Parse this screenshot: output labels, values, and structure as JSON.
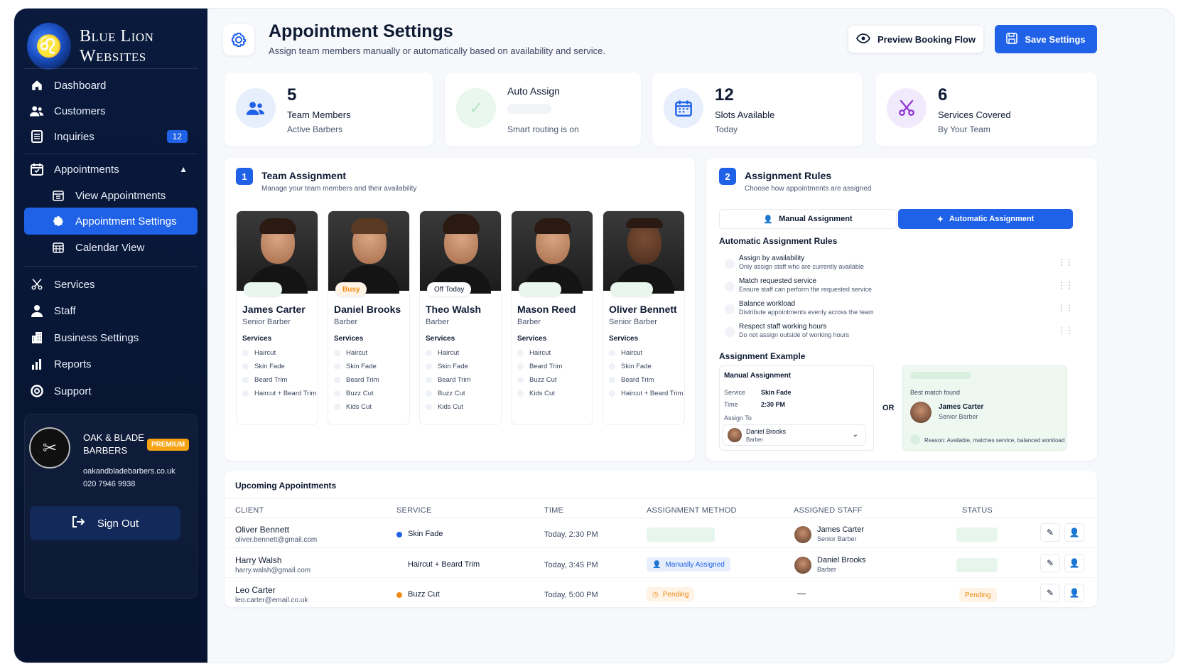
{
  "brand": {
    "name": "Blue Lion Websites",
    "line1": "Blue Lion",
    "line2": "Websites"
  },
  "colors": {
    "accent": "#1f62e8",
    "sidebar": "#0a1a3d",
    "busy": "#f08a12",
    "premium": "#f6a313",
    "success": "#22a35a"
  },
  "sidebar": {
    "items": [
      {
        "label": "Dashboard",
        "icon": "home-icon"
      },
      {
        "label": "Customers",
        "icon": "users-icon"
      },
      {
        "label": "Inquiries",
        "icon": "list-icon",
        "badge": "12"
      },
      {
        "label": "Appointments",
        "icon": "calendar-icon",
        "expanded": true
      },
      {
        "label": "View Appointments",
        "icon": "calendar-list-icon"
      },
      {
        "label": "Appointment Settings",
        "icon": "gear-icon",
        "active": true
      },
      {
        "label": "Calendar View",
        "icon": "calendar-grid-icon"
      },
      {
        "label": "Services",
        "icon": "scissors-icon"
      },
      {
        "label": "Staff",
        "icon": "person-icon"
      },
      {
        "label": "Business Settings",
        "icon": "building-icon"
      },
      {
        "label": "Reports",
        "icon": "bar-chart-icon"
      },
      {
        "label": "Support",
        "icon": "lifebuoy-icon"
      }
    ],
    "business": {
      "name_line1": "OAK & BLADE",
      "name_line2": "BARBERS",
      "badge": "PREMIUM",
      "website": "oakandbladebarbers.co.uk",
      "phone": "020 7946 9938"
    },
    "signout": "Sign Out"
  },
  "header": {
    "title": "Appointment Settings",
    "subtitle": "Assign team members manually or automatically based on availability and service.",
    "preview_label": "Preview Booking Flow",
    "save_label": "Save Settings"
  },
  "stats": [
    {
      "value": "5",
      "label": "Team Members",
      "sub": "Active Barbers",
      "icon": "users-icon"
    },
    {
      "value": "",
      "label": "Auto Assign",
      "sub": "Smart routing is on",
      "icon": "check-circle-icon"
    },
    {
      "value": "12",
      "label": "Slots Available",
      "sub": "Today",
      "icon": "calendar-icon"
    },
    {
      "value": "6",
      "label": "Services Covered",
      "sub": "By Your Team",
      "icon": "scissors-icon"
    }
  ],
  "team": {
    "step": "1",
    "title": "Team Assignment",
    "subtitle": "Manage your team members and their availability",
    "services_label": "Services",
    "members": [
      {
        "name": "James Carter",
        "role": "Senior Barber",
        "status": "",
        "services": [
          "Haircut",
          "Skin Fade",
          "Beard Trim",
          "Haircut + Beard Trim"
        ]
      },
      {
        "name": "Daniel Brooks",
        "role": "Barber",
        "status": "Busy",
        "services": [
          "Haircut",
          "Skin Fade",
          "Beard Trim",
          "Buzz Cut",
          "Kids Cut"
        ]
      },
      {
        "name": "Theo Walsh",
        "role": "Barber",
        "status": "Off Today",
        "services": [
          "Haircut",
          "Skin Fade",
          "Beard Trim",
          "Buzz Cut",
          "Kids Cut"
        ]
      },
      {
        "name": "Mason Reed",
        "role": "Barber",
        "status": "",
        "services": [
          "Haircut",
          "Beard Trim",
          "Buzz Cut",
          "Kids Cut"
        ]
      },
      {
        "name": "Oliver Bennett",
        "role": "Senior Barber",
        "status": "",
        "services": [
          "Haircut",
          "Skin Fade",
          "Beard Trim",
          "Haircut + Beard Trim"
        ]
      }
    ]
  },
  "rules": {
    "step": "2",
    "title": "Assignment Rules",
    "subtitle": "Choose how appointments are assigned",
    "manual_label": "Manual Assignment",
    "auto_label": "Automatic Assignment",
    "auto_rules_title": "Automatic Assignment Rules",
    "items": [
      {
        "title": "Assign by availability",
        "desc": "Only assign staff who are currently available"
      },
      {
        "title": "Match requested service",
        "desc": "Ensure staff can perform the requested service"
      },
      {
        "title": "Balance workload",
        "desc": "Distribute appointments evenly across the team"
      },
      {
        "title": "Respect staff working hours",
        "desc": "Do not assign outside of working hours"
      }
    ],
    "example": {
      "title": "Assignment Example",
      "manual_title": "Manual Assignment",
      "service_label": "Service",
      "service_value": "Skin Fade",
      "time_label": "Time",
      "time_value": "2:30 PM",
      "assign_to_label": "Assign To",
      "assign_name": "Daniel Brooks",
      "assign_role": "Barber",
      "or": "OR",
      "best_match": "Best match found",
      "match_name": "James Carter",
      "match_role": "Senior Barber",
      "reason": "Reason: Available, matches service, balanced workload"
    }
  },
  "upcoming": {
    "title": "Upcoming Appointments",
    "columns": [
      "CLIENT",
      "SERVICE",
      "TIME",
      "ASSIGNMENT METHOD",
      "ASSIGNED STAFF",
      "STATUS"
    ],
    "rows": [
      {
        "client": "Oliver Bennett",
        "email": "oliver.bennett@gmail.com",
        "service": "Skin Fade",
        "dot": "#1f62e8",
        "time": "Today, 2:30 PM",
        "method": "",
        "staff": "James Carter",
        "staff_role": "Senior Barber",
        "status": ""
      },
      {
        "client": "Harry Walsh",
        "email": "harry.walsh@gmail.com",
        "service": "Haircut + Beard Trim",
        "dot": "",
        "time": "Today, 3:45 PM",
        "method": "Manually Assigned",
        "staff": "Daniel Brooks",
        "staff_role": "Barber",
        "status": ""
      },
      {
        "client": "Leo Carter",
        "email": "leo.carter@email.co.uk",
        "service": "Buzz Cut",
        "dot": "#f08a12",
        "time": "Today, 5:00 PM",
        "method": "Pending",
        "staff": "—",
        "staff_role": "",
        "status": "Pending"
      }
    ]
  }
}
